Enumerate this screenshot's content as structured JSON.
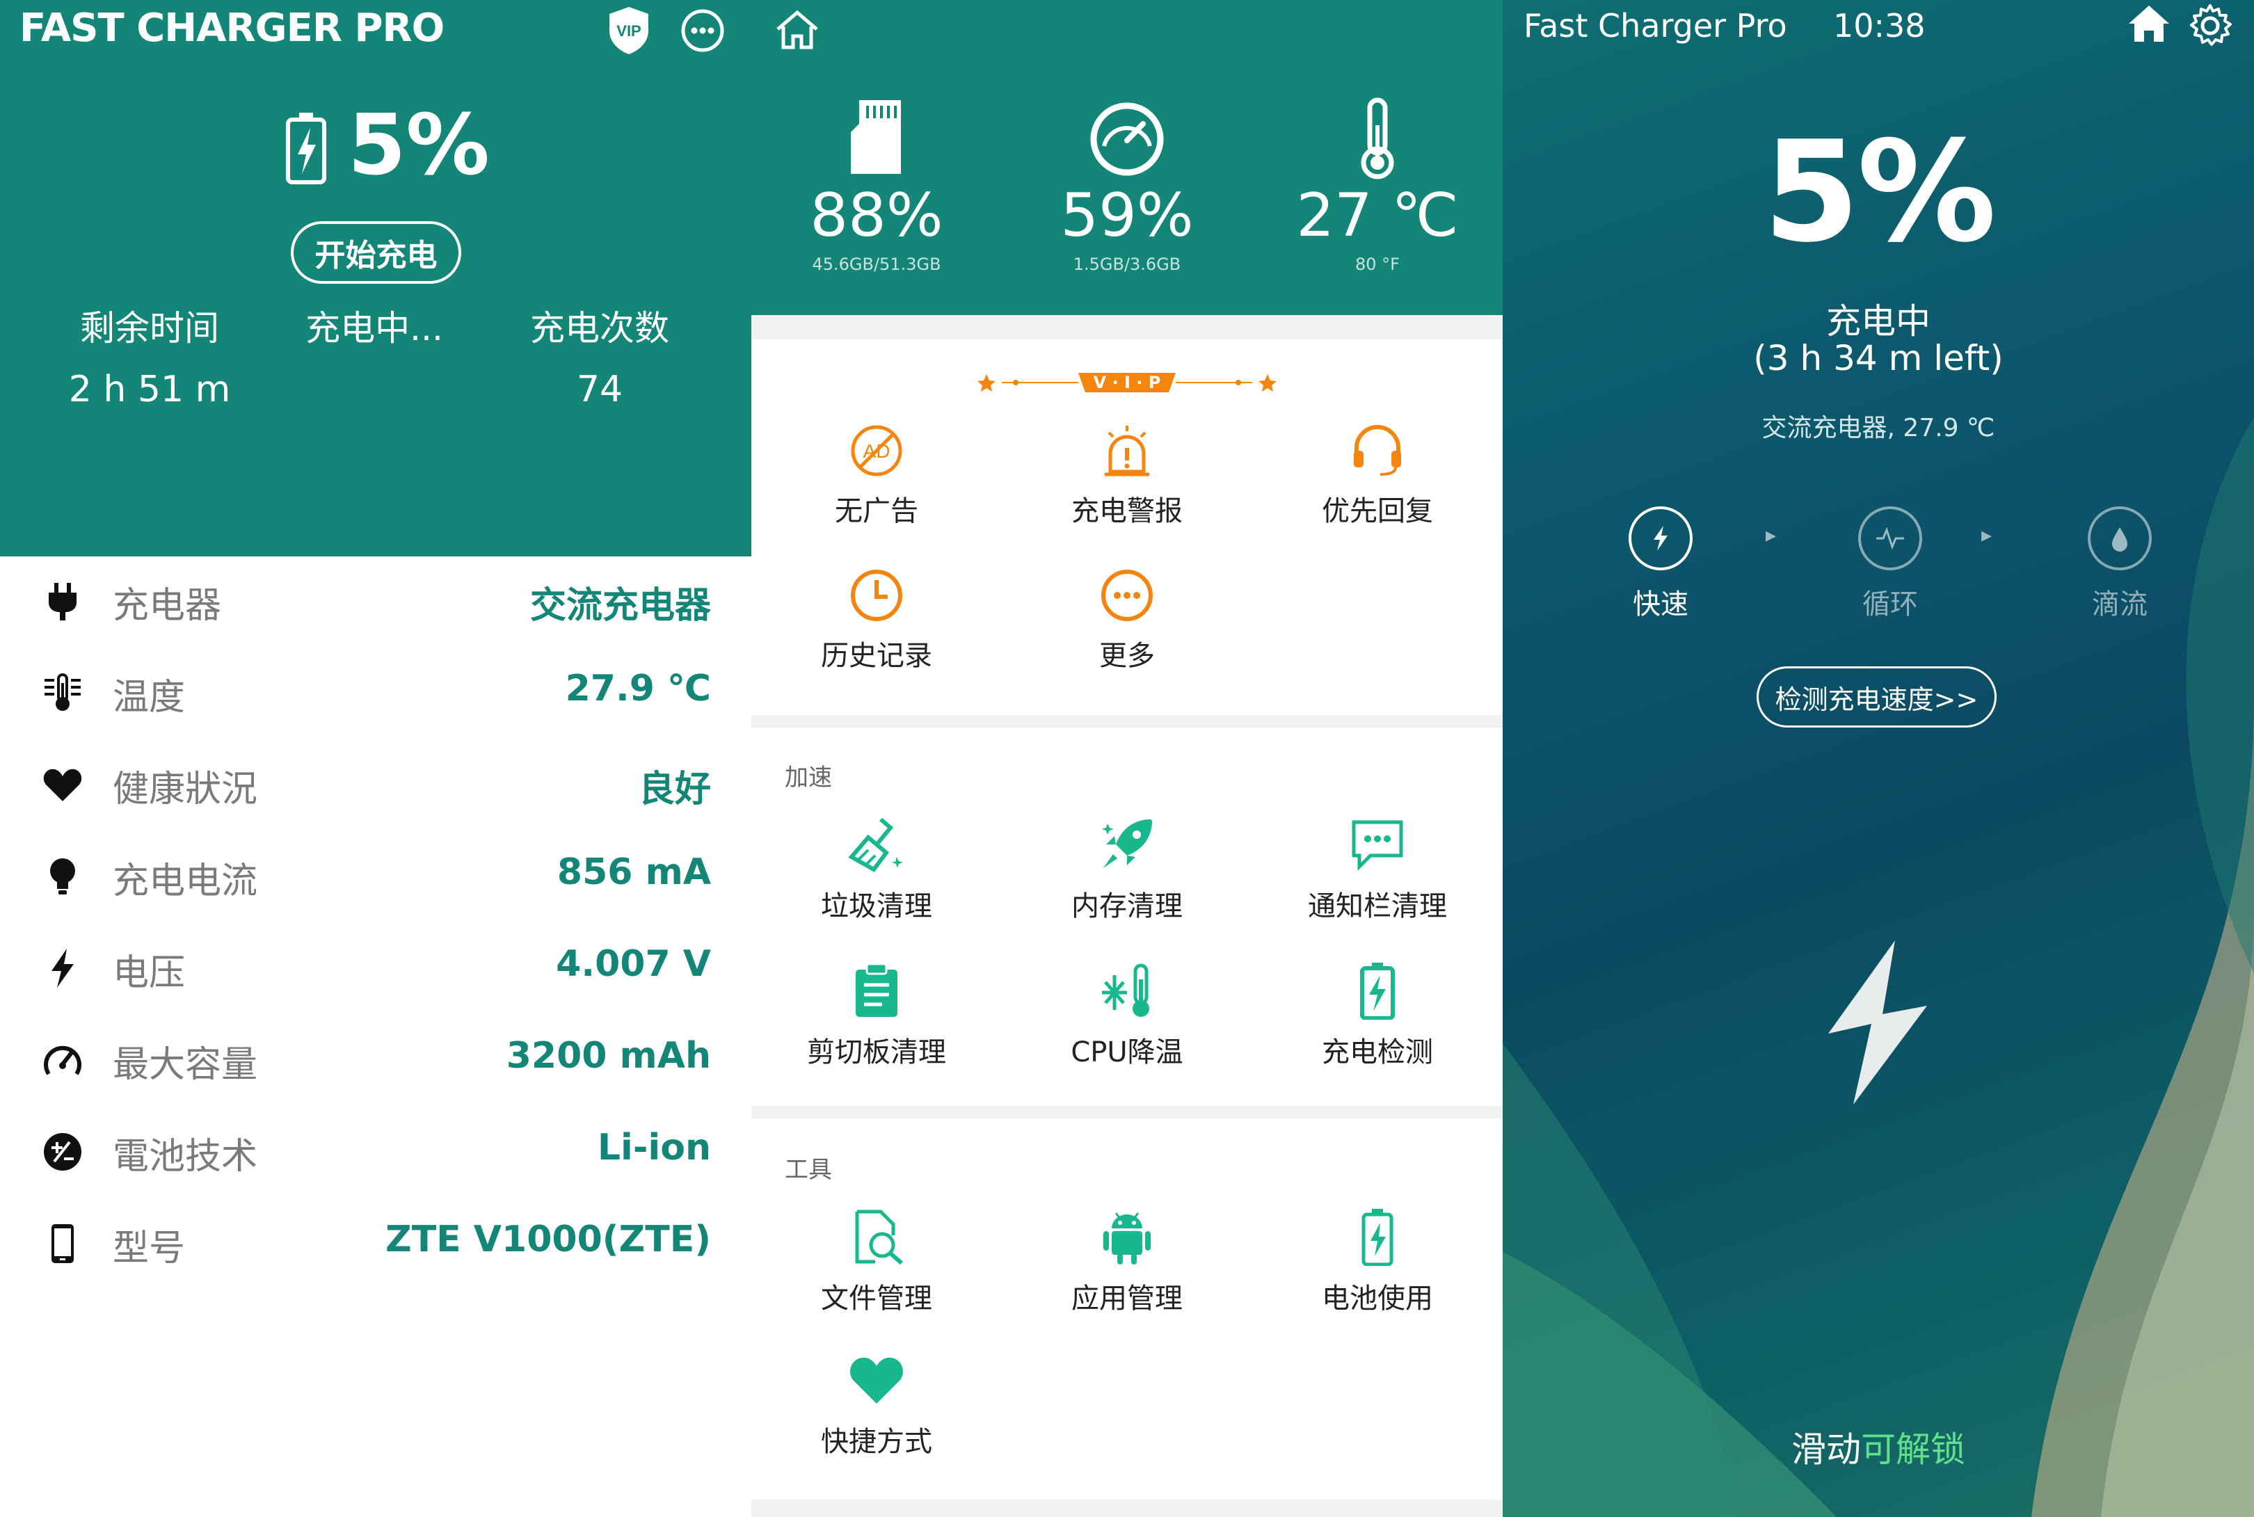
{
  "panel1": {
    "title": "FAST CHARGER PRO",
    "vip_badge": "VIP",
    "battery_percent": "5%",
    "start_button": "开始充电",
    "stats": [
      {
        "label": "剩余时间",
        "value": "2 h 51  m"
      },
      {
        "label": "充电中...",
        "value": ""
      },
      {
        "label": "充电次数",
        "value": "74"
      }
    ],
    "info_rows": [
      {
        "icon": "plug-icon",
        "label": "充电器",
        "value": "交流充电器"
      },
      {
        "icon": "thermometer-icon",
        "label": "温度",
        "value": "27.9 ℃"
      },
      {
        "icon": "heart-icon",
        "label": "健康狀況",
        "value": "良好"
      },
      {
        "icon": "bulb-icon",
        "label": "充电电流",
        "value": "856 mA"
      },
      {
        "icon": "bolt-icon",
        "label": "电压",
        "value": "4.007 V"
      },
      {
        "icon": "gauge-icon",
        "label": "最大容量",
        "value": "3200 mAh"
      },
      {
        "icon": "battery-tech-icon",
        "label": "電池技术",
        "value": "Li-ion"
      },
      {
        "icon": "phone-icon",
        "label": "型号",
        "value": "ZTE V1000(ZTE)"
      }
    ]
  },
  "panel2": {
    "metrics": [
      {
        "icon": "sd-card-icon",
        "value": "88%",
        "sub": "45.6GB/51.3GB"
      },
      {
        "icon": "speedometer-icon",
        "value": "59%",
        "sub": "1.5GB/3.6GB"
      },
      {
        "icon": "thermometer-icon",
        "value": "27 ℃",
        "sub": "80 °F"
      }
    ],
    "vip_banner": "V · I · P",
    "vip_items": [
      "无广告",
      "充电警报",
      "优先回复",
      "历史记录",
      "更多"
    ],
    "section_speed": "加速",
    "speed_items": [
      "垃圾清理",
      "内存清理",
      "通知栏清理",
      "剪切板清理",
      "CPU降温",
      "充电检测"
    ],
    "section_tools": "工具",
    "tool_items": [
      "文件管理",
      "应用管理",
      "电池使用",
      "快捷方式"
    ],
    "colors": {
      "orange": "#f5850c",
      "teal": "#18b78e"
    }
  },
  "panel3": {
    "app_name": "Fast Charger Pro",
    "time": "10:38",
    "battery_percent": "5%",
    "status": "充电中",
    "time_left": "(3 h 34 m left)",
    "charger_info": "交流充电器, 27.9 ℃",
    "modes": [
      "快速",
      "循环",
      "滴流"
    ],
    "detect_button": "检测充电速度>>",
    "unlock_prefix": "滑动",
    "unlock_suffix": "可解锁"
  },
  "colors": {
    "primary": "#138677",
    "accent_orange": "#f5850c",
    "accent_green": "#18b78e"
  }
}
